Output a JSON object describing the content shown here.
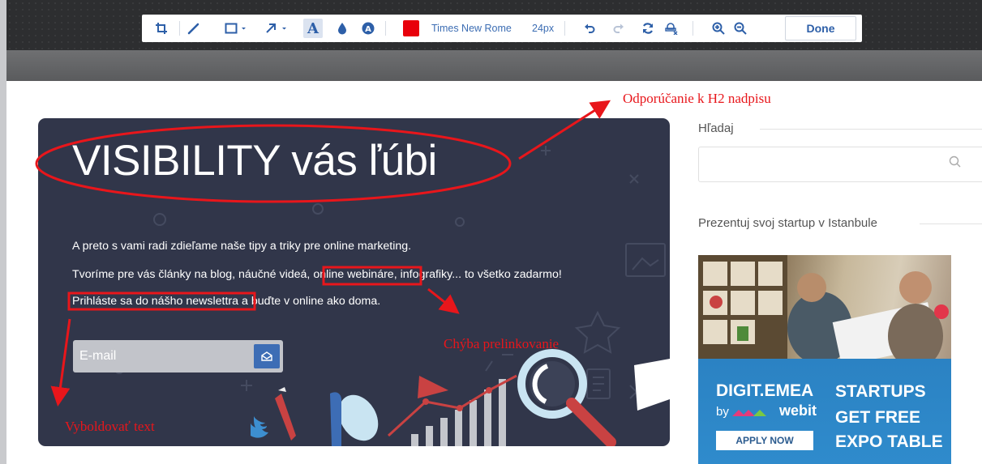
{
  "toolbar": {
    "font_name": "Times New Rome",
    "font_size": "24px",
    "done_label": "Done",
    "text_color": "#e8000b",
    "tools": [
      "crop-icon",
      "pen-icon",
      "rectangle-icon",
      "arrow-icon",
      "text-icon",
      "blur-icon",
      "blur-region-icon",
      "undo-icon",
      "redo-icon",
      "reset-icon",
      "clear-icon",
      "zoom-in-icon",
      "zoom-out-icon"
    ]
  },
  "annotations": {
    "h2_note": "Odporúčanie k H2 nadpisu",
    "link_note": "Chýba prelinkovanie",
    "bold_note": "Vyboldovať text",
    "color": "#e8161b"
  },
  "hero": {
    "title": "VISIBILITY vás ľúbi",
    "line1": "A preto s vami radi zdieľame naše tipy a triky pre online marketing.",
    "line2_a": "Tvoríme pre vás články na blog, náučné videá, ",
    "line2_link": "online webináre,",
    "line2_b": " infografiky... to všetko zadarmo!",
    "line3_a": "Prihláste sa do nášho newslettra",
    "line3_b": " a buďte v online ako doma.",
    "email_placeholder": "E-mail",
    "background": "#31364a"
  },
  "sidebar": {
    "search_label": "Hľadaj",
    "promo_label": "Prezentuj svoj startup v Istanbule",
    "ad": {
      "title": "DIGIT.EMEA",
      "by": "by",
      "brand": "webit",
      "apply": "APPLY NOW",
      "line1": "STARTUPS",
      "line2": "GET FREE",
      "line3": "EXPO TABLE"
    }
  }
}
